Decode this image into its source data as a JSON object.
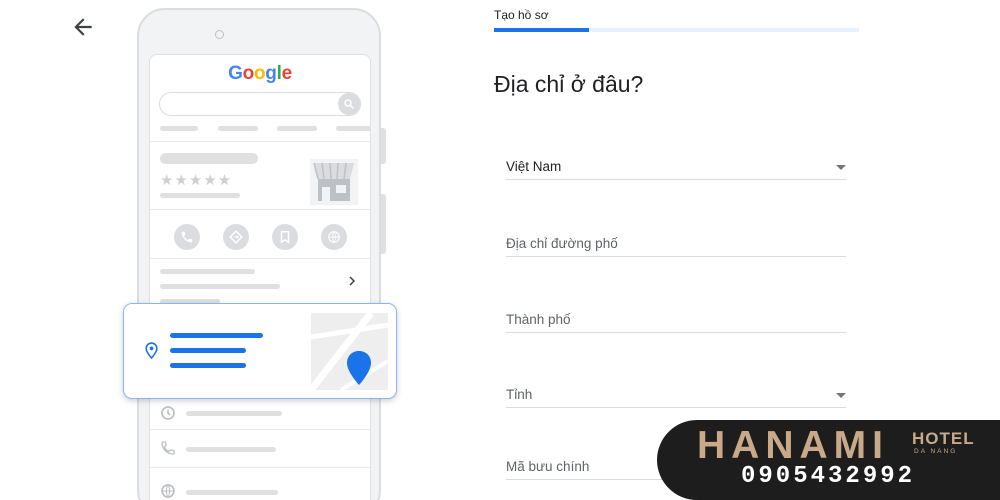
{
  "step": {
    "label": "Tạo hồ sơ",
    "progress_fraction": 0.26
  },
  "form": {
    "title": "Địa chỉ ở đâu?",
    "fields": [
      {
        "name": "country",
        "value": "Việt Nam",
        "placeholder": "",
        "has_dropdown": true
      },
      {
        "name": "street",
        "value": "",
        "placeholder": "Địa chỉ đường phố",
        "has_dropdown": false
      },
      {
        "name": "city",
        "value": "",
        "placeholder": "Thành phố",
        "has_dropdown": false
      },
      {
        "name": "province",
        "value": "",
        "placeholder": "Tỉnh",
        "has_dropdown": true
      },
      {
        "name": "postal",
        "value": "",
        "placeholder": "Mã bưu chính",
        "has_dropdown": false
      }
    ]
  },
  "mockup": {
    "logo": {
      "G": "G",
      "o1": "o",
      "o2": "o",
      "g": "g",
      "l": "l",
      "e": "e"
    },
    "stars": "★★★★★",
    "icons": [
      "back-arrow-icon",
      "search-icon",
      "store-icon",
      "phone-icon",
      "directions-icon",
      "bookmark-icon",
      "globe-icon",
      "chevron-right-icon",
      "clock-icon",
      "location-pin-icon",
      "map-pin-icon"
    ]
  },
  "watermark": {
    "brand": "HANAMI",
    "hotel": "HOTEL",
    "city": "DA NANG",
    "phone": "0905432992"
  },
  "colors": {
    "accent": "#1a73e8",
    "progress_track": "#e8f0fe",
    "card_border": "#8ab4f8",
    "watermark_gold": "#c9a989",
    "watermark_bg": "#1d1d1d"
  }
}
